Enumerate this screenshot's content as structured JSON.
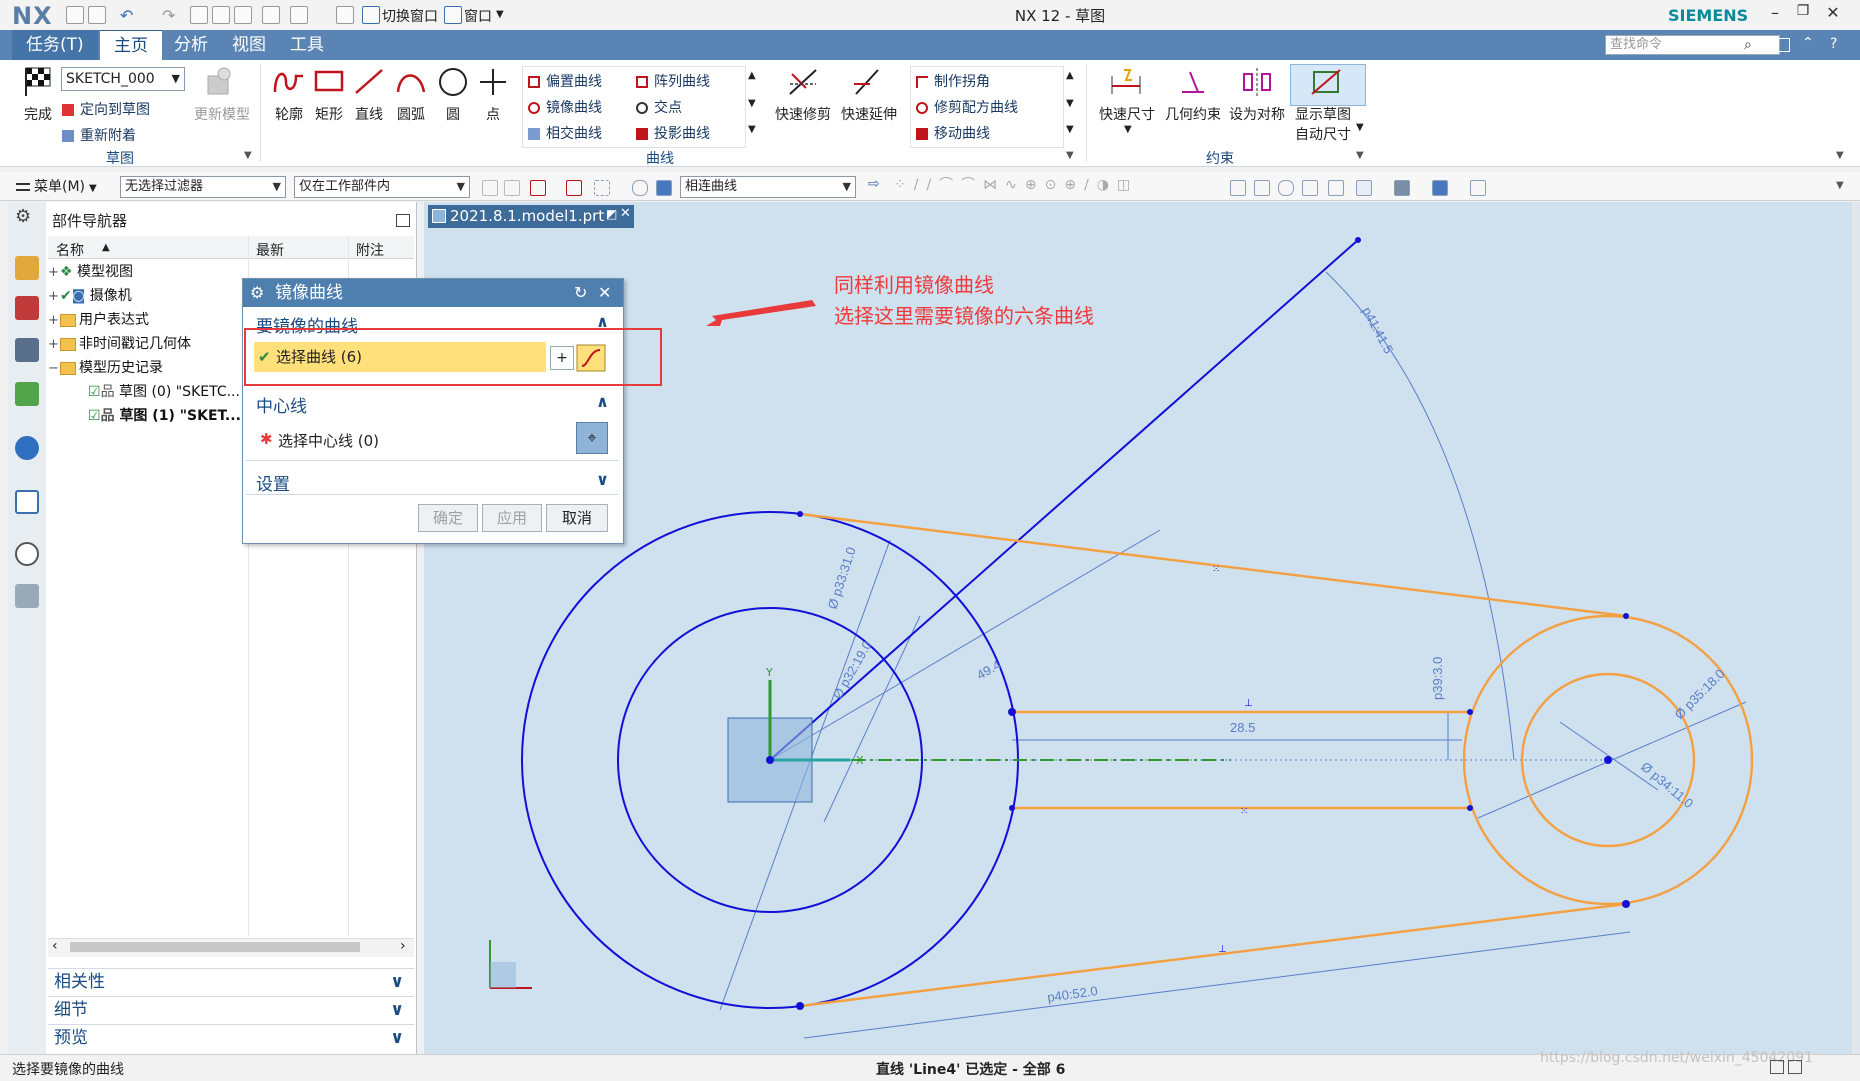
{
  "app": {
    "logo": "NX",
    "window_title": "NX 12 - 草图",
    "brand": "SIEMENS",
    "quick_access": {
      "switch_window": "切换窗口",
      "window_menu": "窗口"
    }
  },
  "ribbon": {
    "tabs": [
      "任务(T)",
      "主页",
      "分析",
      "视图",
      "工具"
    ],
    "active_tab": "主页",
    "search_placeholder": "查找命令",
    "sketch_group": {
      "title": "草图",
      "finish": "完成",
      "sketch_name": "SKETCH_000",
      "orient": "定向到草图",
      "reattach": "重新附着",
      "update_model": "更新模型"
    },
    "curve_group": {
      "title": "曲线",
      "big_buttons": [
        "轮廓",
        "矩形",
        "直线",
        "圆弧",
        "圆",
        "点"
      ],
      "col1": [
        "偏置曲线",
        "镜像曲线",
        "相交曲线"
      ],
      "col2": [
        "阵列曲线",
        "交点",
        "投影曲线"
      ],
      "quick_trim": "快速修剪",
      "quick_extend": "快速延伸",
      "col3": [
        "制作拐角",
        "修剪配方曲线",
        "移动曲线"
      ]
    },
    "constraint_group": {
      "title": "约束",
      "buttons": [
        "快速尺寸",
        "几何约束",
        "设为对称",
        "显示草图"
      ],
      "auto_dim": "自动尺寸"
    }
  },
  "toolbar": {
    "menu": "菜单(M)",
    "filter": "无选择过滤器",
    "scope": "仅在工作部件内",
    "curve_rule": "相连曲线"
  },
  "navigator": {
    "title": "部件导航器",
    "columns": [
      "名称",
      "最新",
      "附注"
    ],
    "items": [
      {
        "label": "模型视图"
      },
      {
        "label": "摄像机"
      },
      {
        "label": "用户表达式"
      },
      {
        "label": "非时间戳记几何体"
      },
      {
        "label": "模型历史记录"
      },
      {
        "label": "草图 (0) \"SKETC..."
      },
      {
        "label": "草图 (1) \"SKET..."
      }
    ],
    "accordions": [
      "相关性",
      "细节",
      "预览"
    ]
  },
  "graphics": {
    "file_tab": "2021.8.1.model1.prt",
    "dimensions": [
      "p41:41.5",
      "Ø p33:31.0",
      "Ø p32:19.0",
      "49.4",
      "p39:3.0",
      "28.5",
      "Ø p35:18.0",
      "Ø p34:11.0",
      "p40:52.0"
    ],
    "axis_labels": {
      "x": "X",
      "y": "Y"
    },
    "annotation": [
      "同样利用镜像曲线",
      "选择这里需要镜像的六条曲线"
    ],
    "colors": {
      "sketch_blue": "#1010d8",
      "selected_orange": "#f4a040",
      "dim_blue": "#5a7ec8",
      "annotation_red": "#e83a3a",
      "background": "#cfe0ef"
    }
  },
  "dialog": {
    "title": "镜像曲线",
    "section_curves": "要镜像的曲线",
    "select_curves": "选择曲线 (6)",
    "section_centerline": "中心线",
    "select_centerline": "选择中心线 (0)",
    "section_settings": "设置",
    "buttons": {
      "ok": "确定",
      "apply": "应用",
      "cancel": "取消"
    }
  },
  "status": {
    "left": "选择要镜像的曲线",
    "center": "直线 'Line4' 已选定 - 全部 6",
    "watermark": "https://blog.csdn.net/weixin_45042091"
  }
}
